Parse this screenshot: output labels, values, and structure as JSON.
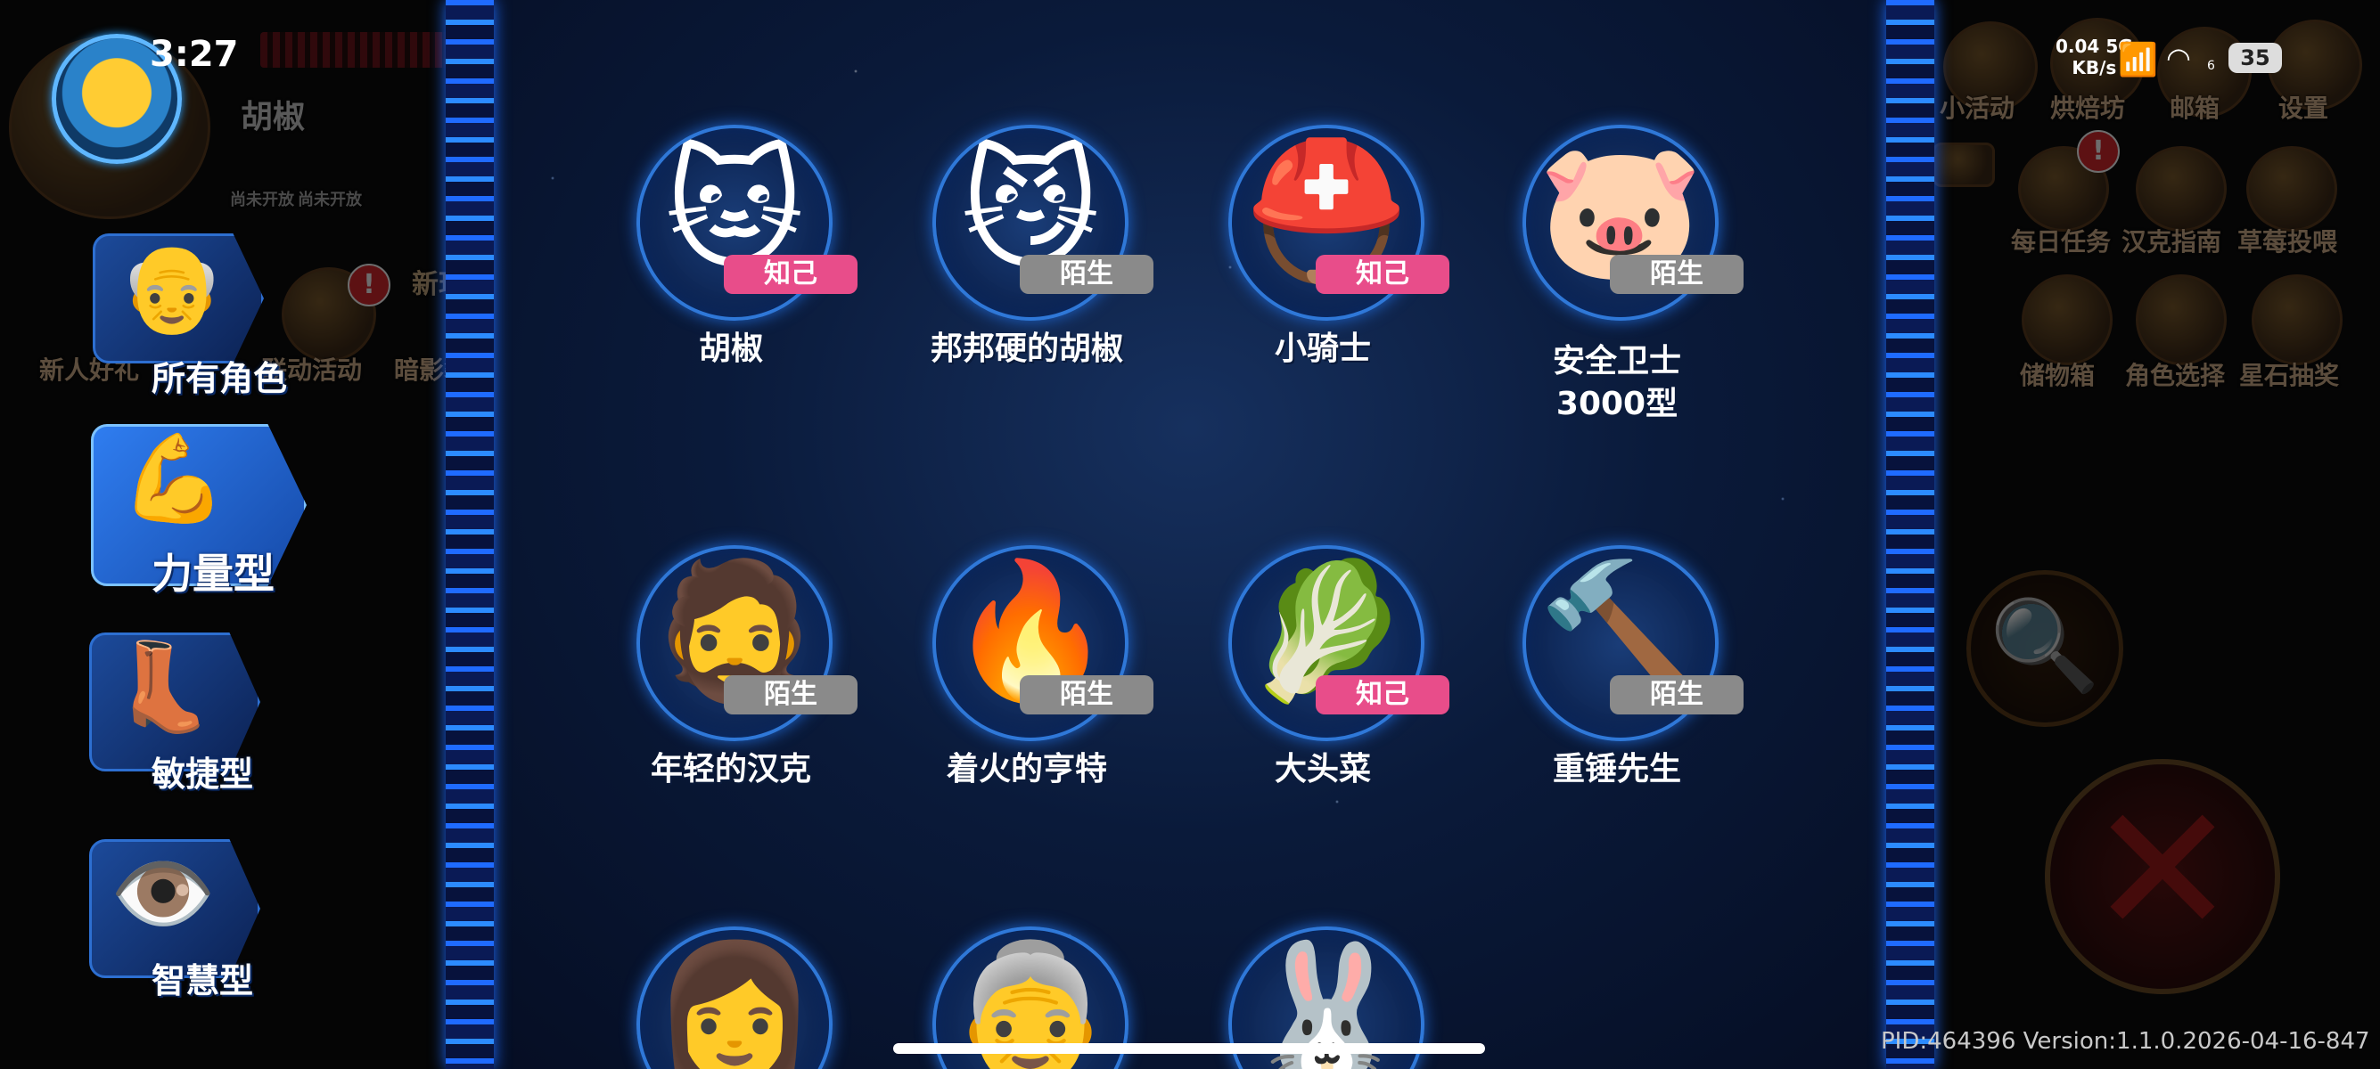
{
  "status_bar": {
    "time": "3:27",
    "net_speed": "0.04",
    "net_unit": "KB/s",
    "network": "5G",
    "wifi_level": "6",
    "battery": "35"
  },
  "player": {
    "name": "胡椒",
    "locked_labels": [
      "尚未开放",
      "尚未开放"
    ]
  },
  "background_left": {
    "new_tag": "新玩",
    "items": [
      "新人好礼",
      "联动活动",
      "暗影裂"
    ]
  },
  "background_right": {
    "top_items": [
      "小活动",
      "烘焙坊",
      "邮箱",
      "设置"
    ],
    "row2": [
      "每日任务",
      "汉克指南",
      "草莓投喂"
    ],
    "row3": [
      "储物箱",
      "角色选择",
      "星石抽奖"
    ],
    "badge": "!"
  },
  "categories": [
    {
      "label": "所有角色",
      "icon": "👴",
      "active": false
    },
    {
      "label": "力量型",
      "icon": "💪",
      "active": true
    },
    {
      "label": "敏捷型",
      "icon": "👢",
      "active": false
    },
    {
      "label": "智慧型",
      "icon": "👁️",
      "active": false
    }
  ],
  "characters": [
    {
      "name": "胡椒",
      "status": "知己",
      "face": "🐱"
    },
    {
      "name": "邦邦硬的胡椒",
      "status": "陌生",
      "face": "😼"
    },
    {
      "name": "小骑士",
      "status": "知己",
      "face": "⛑️"
    },
    {
      "name": "安全卫士\n3000型",
      "status": "陌生",
      "face": "🐷"
    },
    {
      "name": "年轻的汉克",
      "status": "陌生",
      "face": "🧔"
    },
    {
      "name": "着火的亨特",
      "status": "陌生",
      "face": "🔥"
    },
    {
      "name": "大头菜",
      "status": "知己",
      "face": "🥬"
    },
    {
      "name": "重锤先生",
      "status": "陌生",
      "face": "🔨"
    },
    {
      "name": "",
      "status": "",
      "face": "👩"
    },
    {
      "name": "",
      "status": "",
      "face": "👵"
    },
    {
      "name": "",
      "status": "",
      "face": "🐰"
    }
  ],
  "footer": {
    "pid": "PID:464396",
    "version": "Version:1.1.0.2026-04-16-847"
  },
  "colors": {
    "known_tag": "#e84d8a",
    "stranger_tag": "#8a8a8a",
    "panel_border": "#1f6bff"
  }
}
